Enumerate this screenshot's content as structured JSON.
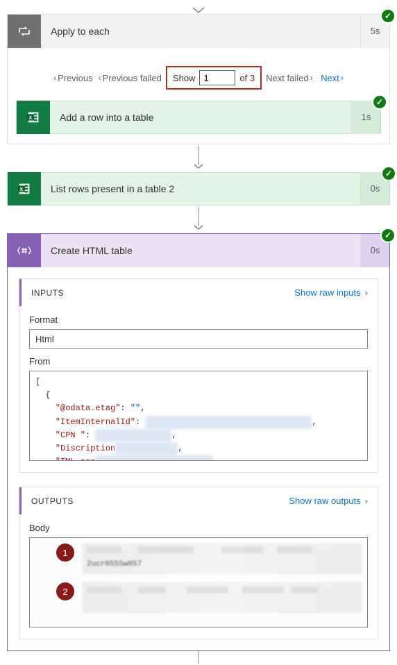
{
  "applyToEach": {
    "title": "Apply to each",
    "time": "5s",
    "badge": "✓",
    "pager": {
      "previous": "Previous",
      "previousFailed": "Previous failed",
      "showLabel": "Show",
      "currentPage": "1",
      "totalLabel": "of 3",
      "nextFailed": "Next failed",
      "next": "Next"
    },
    "addRow": {
      "title": "Add a row into a table",
      "time": "1s",
      "badge": "✓"
    }
  },
  "listRows": {
    "title": "List rows present in a table 2",
    "time": "0s",
    "badge": "✓"
  },
  "createHtml": {
    "title": "Create HTML table",
    "time": "0s",
    "badge": "✓",
    "inputs": {
      "heading": "INPUTS",
      "rawLink": "Show raw inputs",
      "formatLabel": "Format",
      "formatValue": "Html",
      "fromLabel": "From",
      "code": {
        "line1": "[",
        "line2": "  {",
        "line3a": "    \"@odata.etag\"",
        "line3b": ": ",
        "line3c": "\"\"",
        "line3d": ",",
        "line4a": "    \"ItemInternalId\"",
        "line4b": ": ",
        "line5a": "    \"CPN \"",
        "line5b": ": ",
        "line6a": "    \"Discription",
        "line7a": "    \"IML ora"
      }
    },
    "outputs": {
      "heading": "OUTPUTS",
      "rawLink": "Show raw outputs",
      "bodyLabel": "Body",
      "badge1": "1",
      "badge2": "2",
      "monoText": "2ucr0555w057"
    }
  }
}
